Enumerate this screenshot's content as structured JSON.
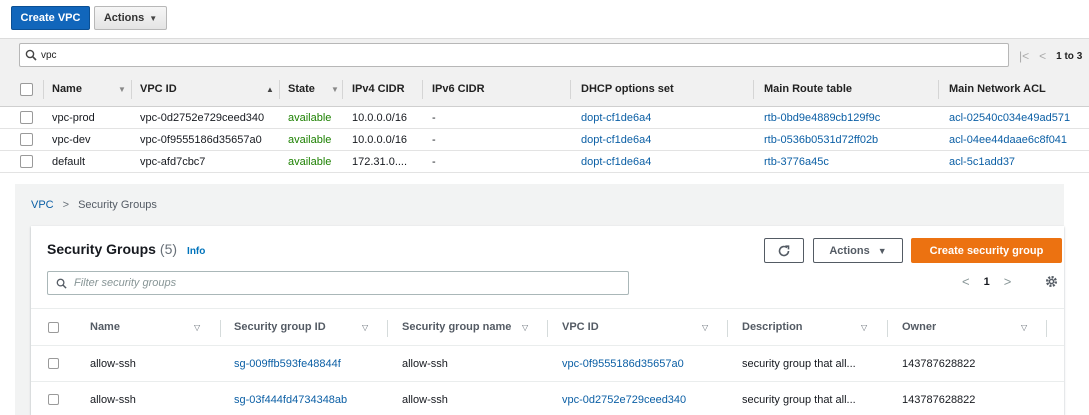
{
  "toolbar": {
    "create_vpc_label": "Create VPC",
    "actions_label": "Actions"
  },
  "vpc_filter": {
    "query": "vpc",
    "pager_text": "1 to 3"
  },
  "vpc_table": {
    "columns": [
      "Name",
      "VPC ID",
      "State",
      "IPv4 CIDR",
      "IPv6 CIDR",
      "DHCP options set",
      "Main Route table",
      "Main Network ACL"
    ],
    "rows": [
      {
        "name": "vpc-prod",
        "vpc_id": "vpc-0d2752e729ceed340",
        "state": "available",
        "ipv4": "10.0.0.0/16",
        "ipv6": "-",
        "dhcp": "dopt-cf1de6a4",
        "route_table": "rtb-0bd9e4889cb129f9c",
        "acl": "acl-02540c034e49ad571"
      },
      {
        "name": "vpc-dev",
        "vpc_id": "vpc-0f9555186d35657a0",
        "state": "available",
        "ipv4": "10.0.0.0/16",
        "ipv6": "-",
        "dhcp": "dopt-cf1de6a4",
        "route_table": "rtb-0536b0531d72ff02b",
        "acl": "acl-04ee44daae6c8f041"
      },
      {
        "name": "default",
        "vpc_id": "vpc-afd7cbc7",
        "state": "available",
        "ipv4": "172.31.0....",
        "ipv6": "-",
        "dhcp": "dopt-cf1de6a4",
        "route_table": "rtb-3776a45c",
        "acl": "acl-5c1add37"
      }
    ]
  },
  "breadcrumb": {
    "root": "VPC",
    "current": "Security Groups"
  },
  "security_groups": {
    "title": "Security Groups",
    "count": "(5)",
    "info": "Info",
    "actions_label": "Actions",
    "create_label": "Create security group",
    "search_placeholder": "Filter security groups",
    "page": "1",
    "columns": [
      "Name",
      "Security group ID",
      "Security group name",
      "VPC ID",
      "Description",
      "Owner"
    ],
    "rows": [
      {
        "name": "allow-ssh",
        "sg_id": "sg-009ffb593fe48844f",
        "sg_name": "allow-ssh",
        "vpc_id": "vpc-0f9555186d35657a0",
        "description": "security group that all...",
        "owner": "143787628822"
      },
      {
        "name": "allow-ssh",
        "sg_id": "sg-03f444fd4734348ab",
        "sg_name": "allow-ssh",
        "vpc_id": "vpc-0d2752e729ceed340",
        "description": "security group that all...",
        "owner": "143787628822"
      }
    ]
  },
  "colors": {
    "primary_blue": "#1166bb",
    "orange": "#ec7211",
    "link": "#0b5fa5",
    "available_green": "#1d8102"
  },
  "icons": [
    "search-icon",
    "first-page-icon",
    "prev-page-icon",
    "next-page-icon",
    "refresh-icon",
    "gear-icon",
    "chevron-right-icon",
    "sort-asc-icon",
    "filter-down-icon"
  ]
}
